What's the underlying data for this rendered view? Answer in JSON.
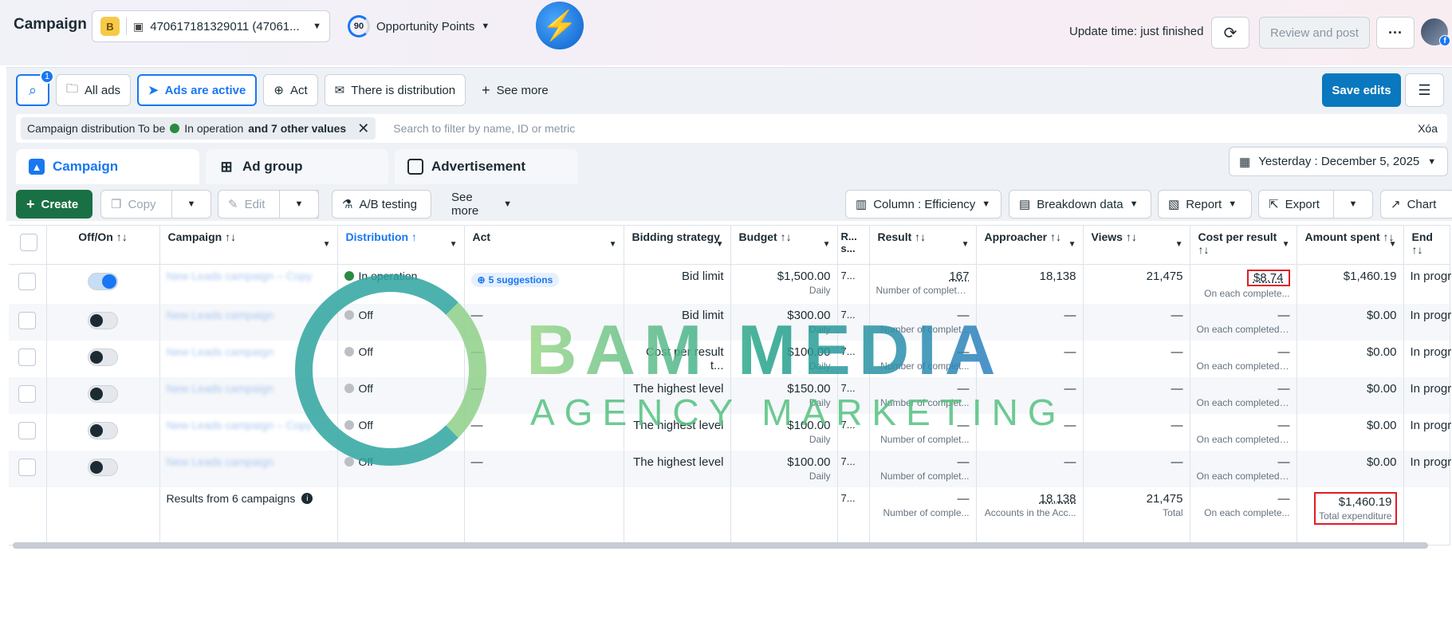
{
  "header": {
    "title": "Campaign",
    "account_badge": "B",
    "account_label": "470617181329011 (47061...",
    "opportunity_score": "90",
    "opportunity_label": "Opportunity Points",
    "update_time": "Update time: just finished",
    "review_label": "Review and post"
  },
  "quick_filters": {
    "search_badge": "1",
    "all_ads": "All ads",
    "ads_active": "Ads are active",
    "act": "Act",
    "distribution": "There is distribution",
    "see_more": "See more",
    "save_edits": "Save edits"
  },
  "filter_bar": {
    "chip_prefix": "Campaign distribution To be",
    "chip_value": "In operation",
    "chip_suffix": "and 7 other values",
    "search_placeholder": "Search to filter by name, ID or metric",
    "clear": "Xóa"
  },
  "tabs": [
    {
      "label": "Campaign"
    },
    {
      "label": "Ad group"
    },
    {
      "label": "Advertisement"
    }
  ],
  "date_range": "Yesterday : December 5, 2025",
  "toolbar": {
    "create": "Create",
    "copy": "Copy",
    "edit": "Edit",
    "ab_testing": "A/B testing",
    "see_more": "See more",
    "column": "Column : Efficiency",
    "breakdown": "Breakdown data",
    "report": "Report",
    "export": "Export",
    "chart": "Chart"
  },
  "table": {
    "headers": {
      "offon": "Off/On ↑↓",
      "campaign": "Campaign ↑↓",
      "distribution": "Distribution ↑",
      "act": "Act",
      "bidding": "Bidding strategy",
      "budget": "Budget ↑↓",
      "rs": "R... s...",
      "result": "Result ↑↓",
      "approacher": "Approacher ↑↓",
      "views": "Views ↑↓",
      "cpr": "Cost per result ↑↓",
      "spent": "Amount spent ↑↓",
      "end": "End ↑↓"
    },
    "rows": [
      {
        "name": "New Leads campaign – Copy",
        "status": "In operation",
        "act": "5 suggestions",
        "bidding": "Bid limit",
        "budget": "$1,500.00",
        "budget_sub": "Daily",
        "rs": "7...",
        "result": "167",
        "result_sub": "Number of complete...",
        "approacher": "18,138",
        "views": "21,475",
        "cpr": "$8.74",
        "cpr_sub": "On each complete...",
        "spent": "$1,460.19",
        "end": "In progress"
      },
      {
        "name": "New Leads campaign",
        "status": "Off",
        "act": "—",
        "bidding": "Bid limit",
        "budget": "$300.00",
        "budget_sub": "Daily",
        "rs": "7...",
        "result": "—",
        "result_sub": "Number of complet...",
        "approacher": "—",
        "views": "—",
        "cpr": "—",
        "cpr_sub": "On each completed ...",
        "spent": "$0.00",
        "end": "In progress"
      },
      {
        "name": "New Leads campaign",
        "status": "Off",
        "act": "—",
        "bidding": "Cost per result t...",
        "budget": "$100.00",
        "budget_sub": "Daily",
        "rs": "7...",
        "result": "—",
        "result_sub": "Number of complet...",
        "approacher": "—",
        "views": "—",
        "cpr": "—",
        "cpr_sub": "On each completed ...",
        "spent": "$0.00",
        "end": "In progress"
      },
      {
        "name": "New Leads campaign",
        "status": "Off",
        "act": "—",
        "bidding": "The highest level",
        "budget": "$150.00",
        "budget_sub": "Daily",
        "rs": "7...",
        "result": "—",
        "result_sub": "Number of complet...",
        "approacher": "—",
        "views": "—",
        "cpr": "—",
        "cpr_sub": "On each completed ...",
        "spent": "$0.00",
        "end": "In progress"
      },
      {
        "name": "New Leads campaign – Copy",
        "status": "Off",
        "act": "—",
        "bidding": "The highest level",
        "budget": "$100.00",
        "budget_sub": "Daily",
        "rs": "7...",
        "result": "—",
        "result_sub": "Number of complet...",
        "approacher": "—",
        "views": "—",
        "cpr": "—",
        "cpr_sub": "On each completed ...",
        "spent": "$0.00",
        "end": "In progress"
      },
      {
        "name": "New Leads campaign",
        "status": "Off",
        "act": "—",
        "bidding": "The highest level",
        "budget": "$100.00",
        "budget_sub": "Daily",
        "rs": "7...",
        "result": "—",
        "result_sub": "Number of complet...",
        "approacher": "—",
        "views": "—",
        "cpr": "—",
        "cpr_sub": "On each completed ...",
        "spent": "$0.00",
        "end": "In progress"
      }
    ],
    "totals": {
      "label": "Results from 6 campaigns",
      "rs": "7...",
      "result": "—",
      "result_sub": "Number of comple...",
      "approacher": "18,138",
      "approacher_sub": "Accounts in the Acc...",
      "views": "21,475",
      "views_sub": "Total",
      "cpr": "—",
      "cpr_sub": "On each complete...",
      "spent": "$1,460.19",
      "spent_sub": "Total expenditure"
    }
  },
  "watermark": {
    "title": "BAM MEDIA",
    "subtitle": "AGENCY MARKETING"
  },
  "colors": {
    "primary": "#1877f2",
    "create_green": "#1a7045",
    "save_blue": "#0a78be",
    "highlight_red": "#e31b23",
    "status_on": "#2a8a3f",
    "status_off": "#bcc0c4"
  }
}
